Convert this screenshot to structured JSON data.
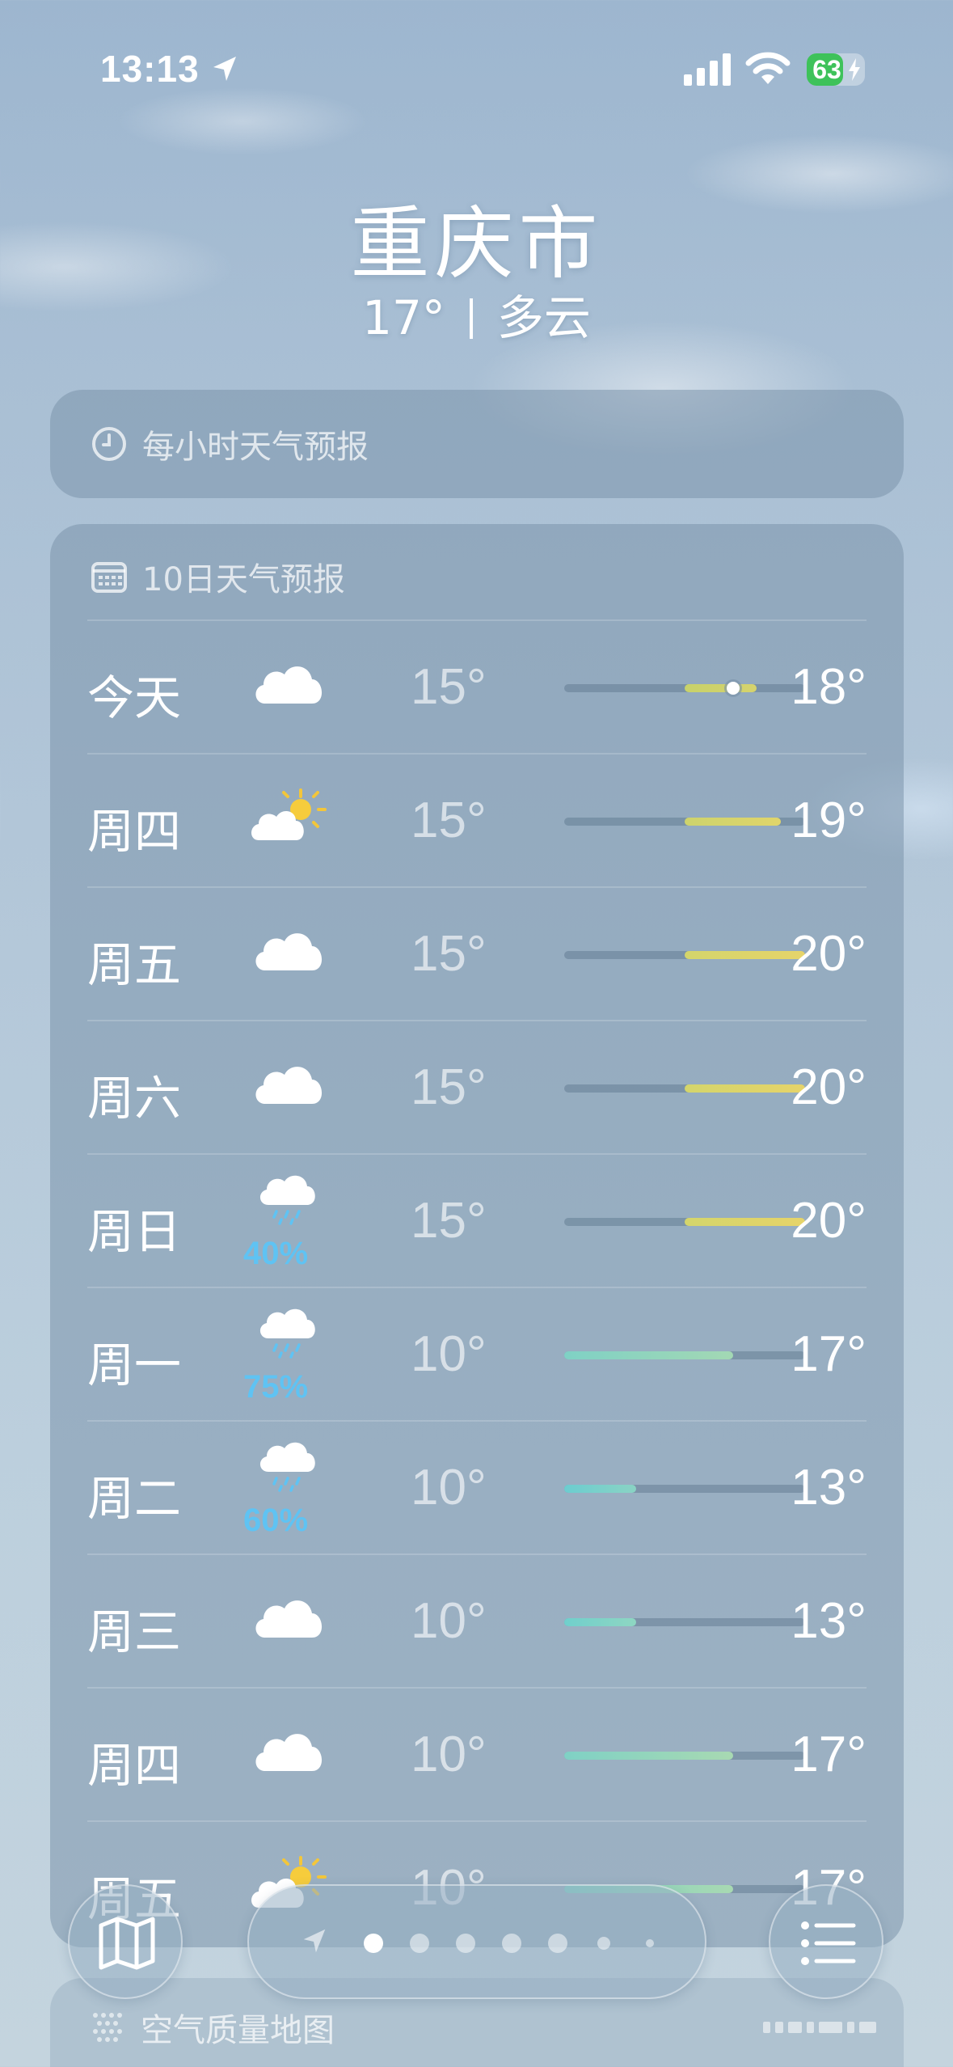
{
  "status_bar": {
    "time": "13:13",
    "battery_percent": "63",
    "battery_level": 0.63,
    "battery_color": "#3ec25a"
  },
  "header": {
    "city": "重庆市",
    "temperature": "17°",
    "condition": "多云"
  },
  "hourly": {
    "title": "每小时天气预报",
    "icon": "clock-icon"
  },
  "ten_day": {
    "title": "10日天气预报",
    "icon": "calendar-icon",
    "range_min": 10,
    "range_max": 20,
    "days": [
      {
        "day": "今天",
        "icon": "cloud-icon",
        "precip": "",
        "low": "15°",
        "high": "18°",
        "low_val": 15,
        "high_val": 18,
        "current_val": 17,
        "colors": [
          "#c8d26a",
          "#d6d36d"
        ]
      },
      {
        "day": "周四",
        "icon": "partly-sunny-icon",
        "precip": "",
        "low": "15°",
        "high": "19°",
        "low_val": 15,
        "high_val": 19,
        "colors": [
          "#cdd36c",
          "#e0d56b"
        ]
      },
      {
        "day": "周五",
        "icon": "cloud-icon",
        "precip": "",
        "low": "15°",
        "high": "20°",
        "low_val": 15,
        "high_val": 20,
        "colors": [
          "#d4d56b",
          "#e6d46a"
        ]
      },
      {
        "day": "周六",
        "icon": "cloud-icon",
        "precip": "",
        "low": "15°",
        "high": "20°",
        "low_val": 15,
        "high_val": 20,
        "colors": [
          "#d4d56b",
          "#e6d46a"
        ]
      },
      {
        "day": "周日",
        "icon": "cloud-rain-icon",
        "precip": "40%",
        "low": "15°",
        "high": "20°",
        "low_val": 15,
        "high_val": 20,
        "colors": [
          "#d4d56b",
          "#e6d46a"
        ]
      },
      {
        "day": "周一",
        "icon": "cloud-rain-icon",
        "precip": "75%",
        "low": "10°",
        "high": "17°",
        "low_val": 10,
        "high_val": 17,
        "colors": [
          "#7fd1c5",
          "#a3d8b4"
        ]
      },
      {
        "day": "周二",
        "icon": "cloud-rain-icon",
        "precip": "60%",
        "low": "10°",
        "high": "13°",
        "low_val": 10,
        "high_val": 13,
        "colors": [
          "#6ccdd0",
          "#8ad3c4"
        ]
      },
      {
        "day": "周三",
        "icon": "cloud-icon",
        "precip": "",
        "low": "10°",
        "high": "13°",
        "low_val": 10,
        "high_val": 13,
        "colors": [
          "#70cfcc",
          "#8ed6c2"
        ]
      },
      {
        "day": "周四",
        "icon": "cloud-icon",
        "precip": "",
        "low": "10°",
        "high": "17°",
        "low_val": 10,
        "high_val": 17,
        "colors": [
          "#7fd1c5",
          "#a8d9b2"
        ]
      },
      {
        "day": "周五",
        "icon": "partly-sunny-icon",
        "precip": "",
        "low": "10°",
        "high": "17°",
        "low_val": 10,
        "high_val": 17,
        "colors": [
          "#7fd1c5",
          "#a8d9b2"
        ]
      }
    ]
  },
  "air_quality": {
    "title": "空气质量地图",
    "icon": "air-quality-icon"
  },
  "bottom_bar": {
    "map_button_icon": "map-icon",
    "list_button_icon": "list-icon",
    "page_count": 7,
    "active_page": 0
  }
}
